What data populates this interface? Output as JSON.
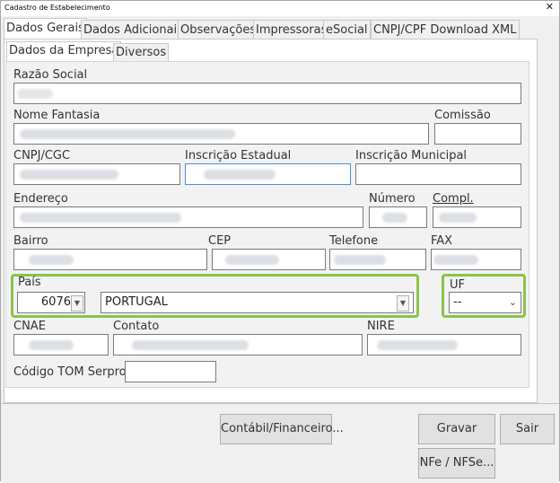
{
  "window": {
    "title": "Cadastro de Estabelecimento",
    "close_glyph": "✕"
  },
  "tabs": [
    "Dados Gerais",
    "Dados Adicionais",
    "Observações",
    "Impressoras",
    "eSocial",
    "CNPJ/CPF Download XML"
  ],
  "subtabs": [
    "Dados da Empresa",
    "Diversos"
  ],
  "form": {
    "razao_social": "Razão Social",
    "nome_fantasia": "Nome Fantasia",
    "comissao": "Comissão",
    "cnpj": "CNPJ/CGC",
    "inscricao_estadual": "Inscrição Estadual",
    "inscricao_municipal": "Inscrição Municipal",
    "endereco": "Endereço",
    "numero": "Número",
    "compl": "Compl.",
    "bairro": "Bairro",
    "cep": "CEP",
    "telefone": "Telefone",
    "fax": "FAX",
    "pais": "País",
    "pais_code": "6076",
    "pais_name": "PORTUGAL",
    "uf": "UF",
    "uf_value": "--",
    "cnae": "CNAE",
    "contato": "Contato",
    "nire": "NIRE",
    "codigo_tom": "Código TOM Serpro"
  },
  "buttons": {
    "contabil": "Contábil/Financeiro...",
    "gravar": "Gravar",
    "sair": "Sair",
    "nfe": "NFe / NFSe..."
  },
  "colors": {
    "highlight": "#8bc34a",
    "focus_border": "#4a90d9"
  }
}
